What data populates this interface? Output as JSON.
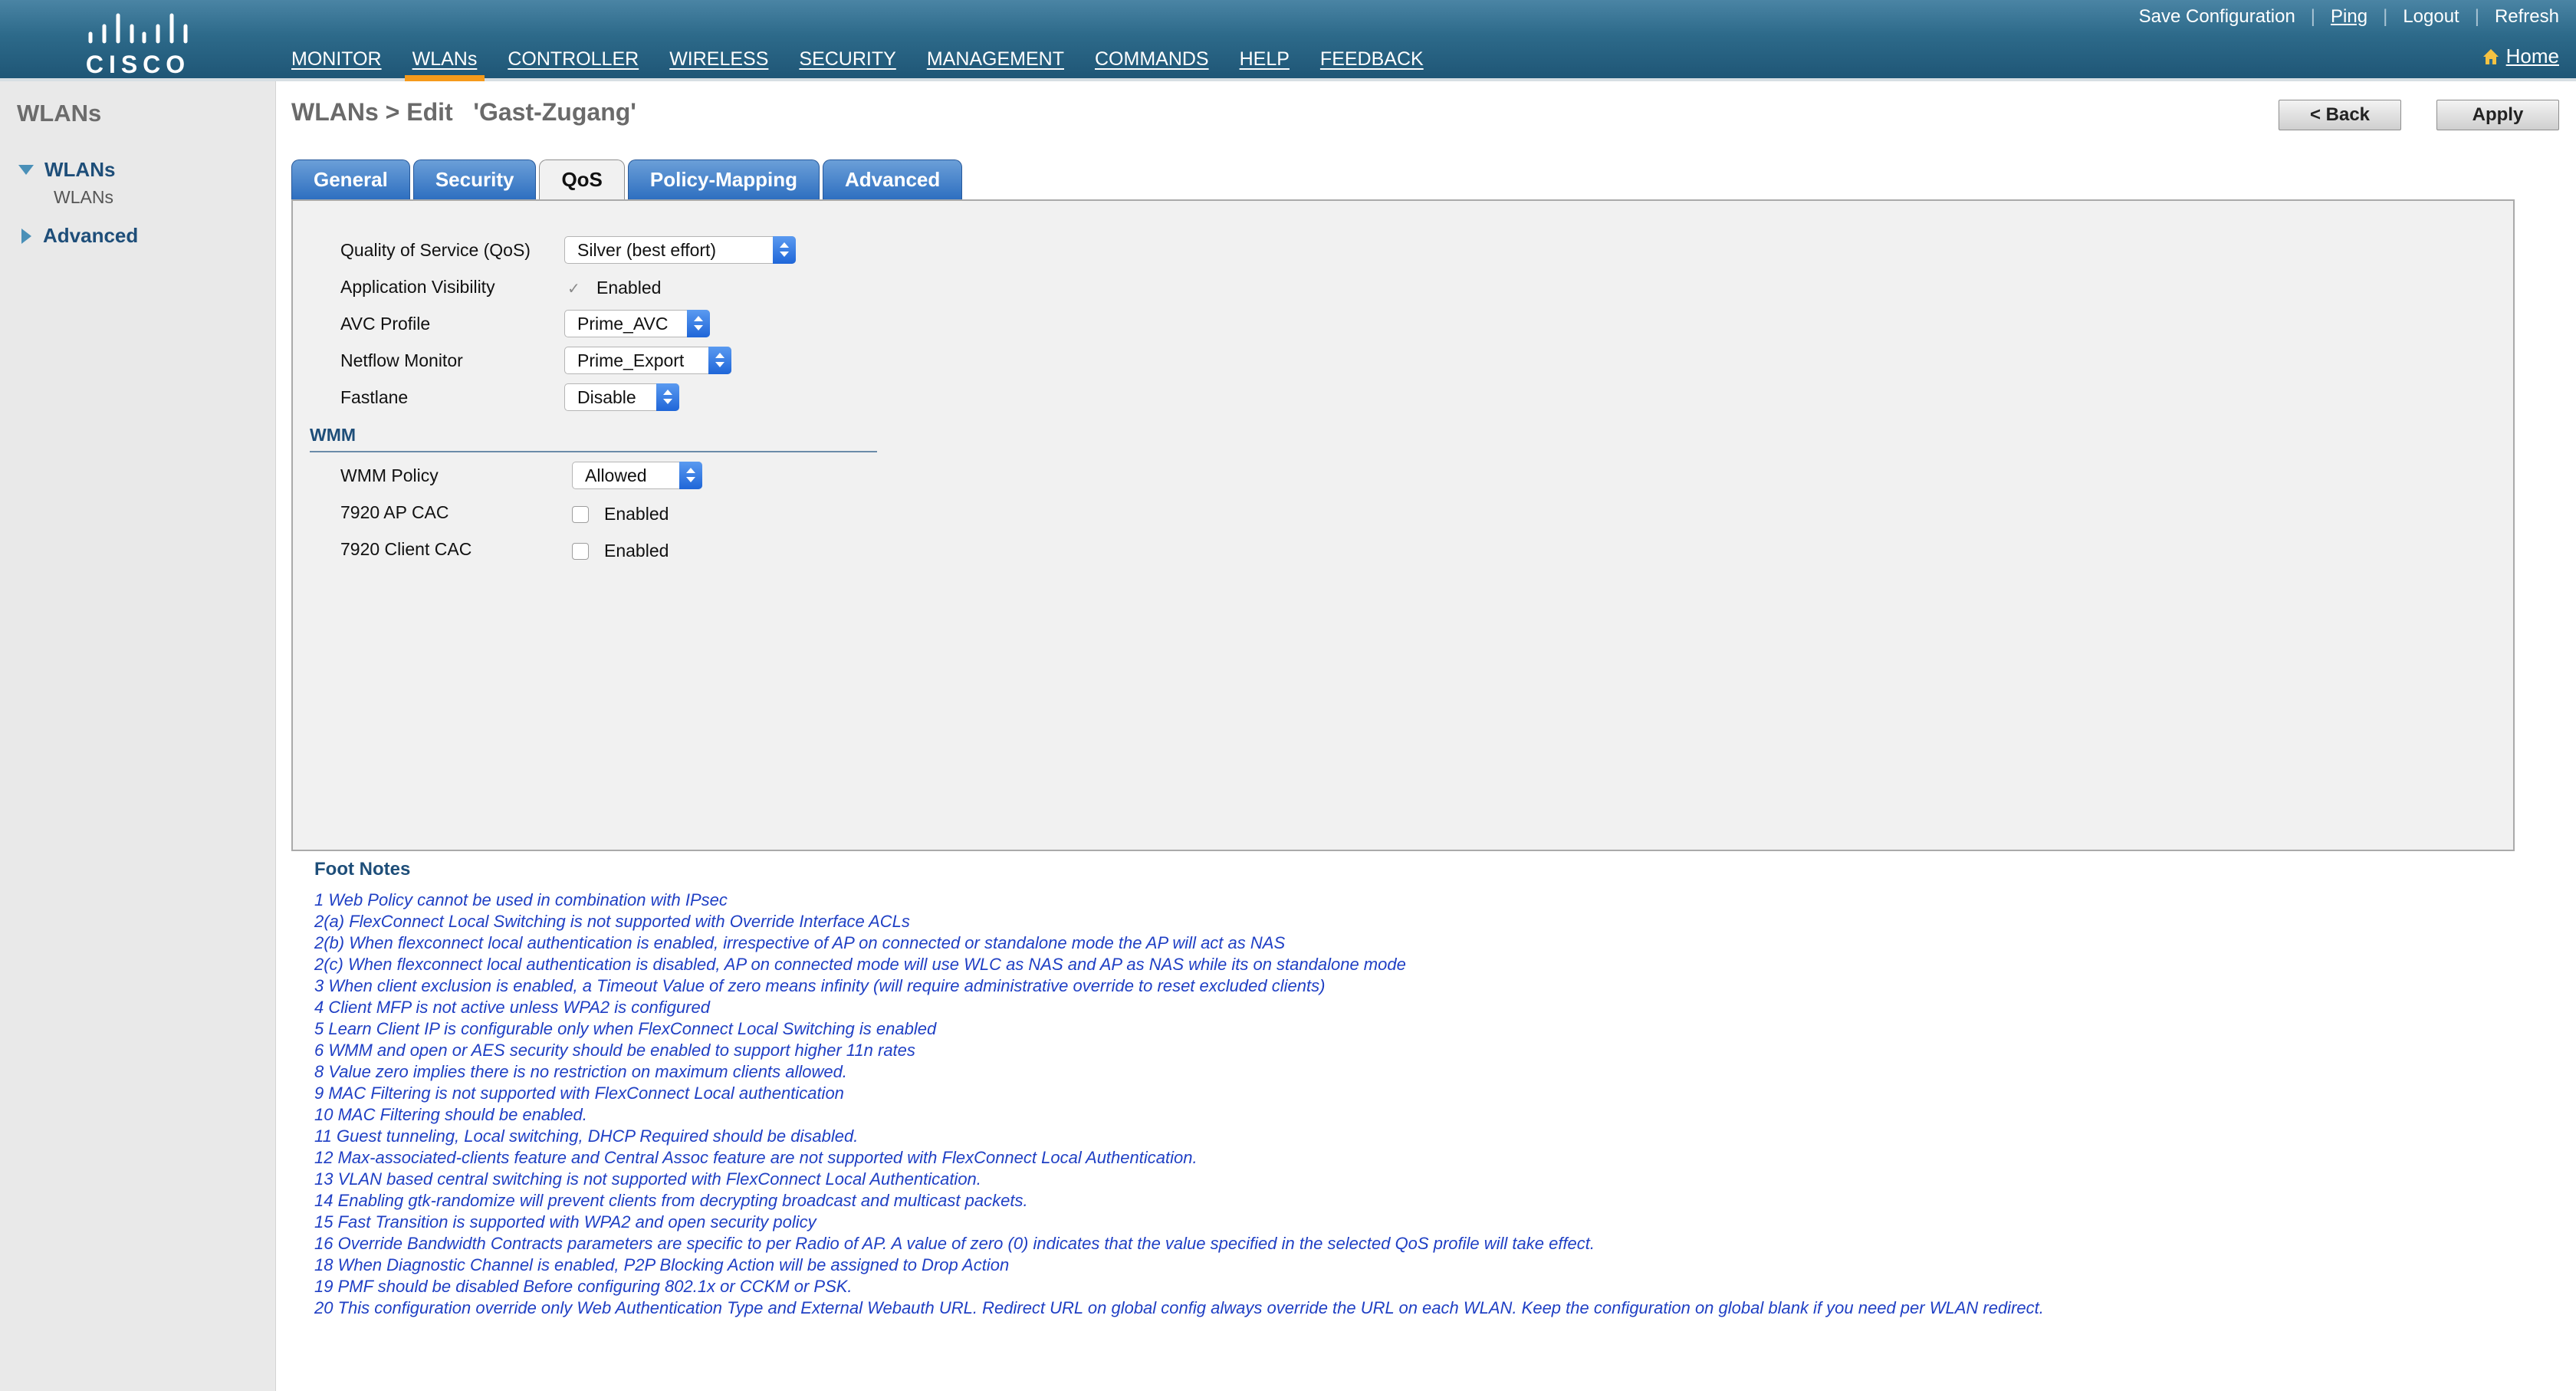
{
  "brand": {
    "logo_text": "CISCO"
  },
  "nav": {
    "items": [
      {
        "label": "MONITOR",
        "active": false
      },
      {
        "label": "WLANs",
        "active": true
      },
      {
        "label": "CONTROLLER",
        "active": false
      },
      {
        "label": "WIRELESS",
        "active": false
      },
      {
        "label": "SECURITY",
        "active": false
      },
      {
        "label": "MANAGEMENT",
        "active": false
      },
      {
        "label": "COMMANDS",
        "active": false
      },
      {
        "label": "HELP",
        "active": false
      },
      {
        "label": "FEEDBACK",
        "active": false
      }
    ],
    "active_underline_color": "#f59a1b"
  },
  "util_nav": {
    "save_configuration": "Save Configuration",
    "ping": "Ping",
    "logout": "Logout",
    "refresh": "Refresh",
    "home": "Home"
  },
  "sidebar": {
    "title": "WLANs",
    "groups": [
      {
        "label": "WLANs",
        "expanded": true,
        "children": [
          "WLANs"
        ]
      },
      {
        "label": "Advanced",
        "expanded": false,
        "children": []
      }
    ]
  },
  "page": {
    "title": "WLANs > Edit   'Gast-Zugang'",
    "back_label": "< Back",
    "apply_label": "Apply"
  },
  "tabs": [
    {
      "label": "General",
      "active": false
    },
    {
      "label": "Security",
      "active": false
    },
    {
      "label": "QoS",
      "active": true
    },
    {
      "label": "Policy-Mapping",
      "active": false
    },
    {
      "label": "Advanced",
      "active": false
    }
  ],
  "qos": {
    "quality_of_service": {
      "label": "Quality of Service (QoS)",
      "value": "Silver (best effort)"
    },
    "application_visibility": {
      "label": "Application Visibility",
      "checkbox_label": "Enabled",
      "checked": true
    },
    "avc_profile": {
      "label": "AVC Profile",
      "value": "Prime_AVC"
    },
    "netflow_monitor": {
      "label": "Netflow Monitor",
      "value": "Prime_Export"
    },
    "fastlane": {
      "label": "Fastlane",
      "value": "Disable"
    }
  },
  "wmm": {
    "header": "WMM",
    "policy": {
      "label": "WMM Policy",
      "value": "Allowed"
    },
    "ap_cac_7920": {
      "label": "7920 AP CAC",
      "checkbox_label": "Enabled",
      "checked": false
    },
    "client_cac_7920": {
      "label": "7920 Client CAC",
      "checkbox_label": "Enabled",
      "checked": false
    }
  },
  "footnotes": {
    "title": "Foot Notes",
    "items": [
      "1 Web Policy cannot be used in combination with IPsec",
      "2(a) FlexConnect Local Switching is not supported with Override Interface ACLs",
      "2(b) When flexconnect local authentication is enabled, irrespective of AP on connected or standalone mode the AP will act as NAS",
      "2(c) When flexconnect local authentication is disabled, AP on connected mode will use WLC as NAS and AP as NAS while its on standalone mode",
      "3 When client exclusion is enabled, a Timeout Value of zero means infinity (will require administrative override to reset excluded clients)",
      "4 Client MFP is not active unless WPA2 is configured",
      "5 Learn Client IP is configurable only when FlexConnect Local Switching is enabled",
      "6 WMM and open or AES security should be enabled to support higher 11n rates",
      "8 Value zero implies there is no restriction on maximum clients allowed.",
      "9 MAC Filtering is not supported with FlexConnect Local authentication",
      "10 MAC Filtering should be enabled.",
      "11 Guest tunneling, Local switching, DHCP Required should be disabled.",
      "12 Max-associated-clients feature and Central Assoc feature are not supported with FlexConnect Local Authentication.",
      "13 VLAN based central switching is not supported with FlexConnect Local Authentication.",
      "14 Enabling gtk-randomize will prevent clients from decrypting broadcast and multicast packets.",
      "15 Fast Transition is supported with WPA2 and open security policy",
      "16 Override Bandwidth Contracts parameters are specific to per Radio of AP. A value of zero (0) indicates that the value specified in the selected QoS profile will take effect.",
      "18 When Diagnostic Channel is enabled, P2P Blocking Action will be assigned to Drop Action",
      "19 PMF should be disabled Before configuring 802.1x or CCKM or PSK.",
      "20 This configuration override only Web Authentication Type and External Webauth URL. Redirect URL on global config always override the URL on each WLAN. Keep the configuration on global blank if you need per WLAN redirect."
    ]
  }
}
